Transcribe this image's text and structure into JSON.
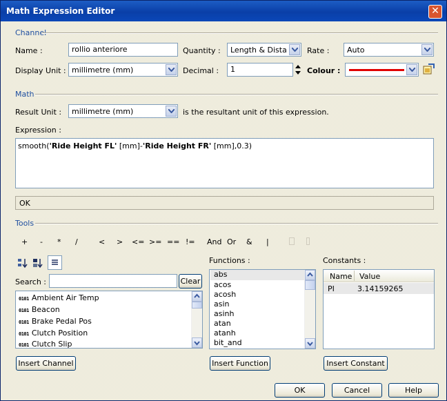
{
  "window": {
    "title": "Math Expression Editor",
    "close": "✕"
  },
  "channel": {
    "section": "Channel",
    "name_label": "Name :",
    "name_value": "rollio anteriore",
    "quantity_label": "Quantity :",
    "quantity_value": "Length & Distance",
    "rate_label": "Rate :",
    "rate_value": "Auto",
    "display_unit_label": "Display Unit :",
    "display_unit_value": "millimetre (mm)",
    "decimal_label": "Decimal :",
    "decimal_value": "1",
    "colour_label": "Colour :",
    "colour_value": "#e00000"
  },
  "math": {
    "section": "Math",
    "result_unit_label": "Result Unit :",
    "result_unit_value": "millimetre (mm)",
    "result_unit_note": "is the resultant unit of this expression.",
    "expression_label": "Expression :",
    "expression_parts": {
      "p1": "smooth(",
      "p2": "'Ride Height FL'",
      "p3": " [mm]-",
      "p4": "'Ride Height FR'",
      "p5": " [mm],0.3)"
    },
    "status": "OK"
  },
  "tools": {
    "section": "Tools",
    "operators": [
      "+",
      "-",
      "*",
      "/",
      "<",
      ">",
      "<=",
      ">=",
      "==",
      "!=",
      "And",
      "Or",
      "&",
      "|"
    ],
    "search_label": "Search :",
    "search_value": "",
    "clear_label": "Clear",
    "channels": [
      "Ambient Air Temp",
      "Beacon",
      "Brake Pedal Pos",
      "Clutch Position",
      "Clutch Slip"
    ],
    "channel_icon": "0101",
    "insert_channel": "Insert Channel",
    "functions_label": "Functions :",
    "functions": [
      "abs",
      "acos",
      "acosh",
      "asin",
      "asinh",
      "atan",
      "atanh",
      "bit_and"
    ],
    "insert_function": "Insert Function",
    "constants_label": "Constants :",
    "constants_headers": [
      "Name",
      "Value"
    ],
    "constants_rows": [
      {
        "name": "PI",
        "value": "3.14159265"
      }
    ],
    "insert_constant": "Insert Constant"
  },
  "footer": {
    "ok": "OK",
    "cancel": "Cancel",
    "help": "Help"
  }
}
